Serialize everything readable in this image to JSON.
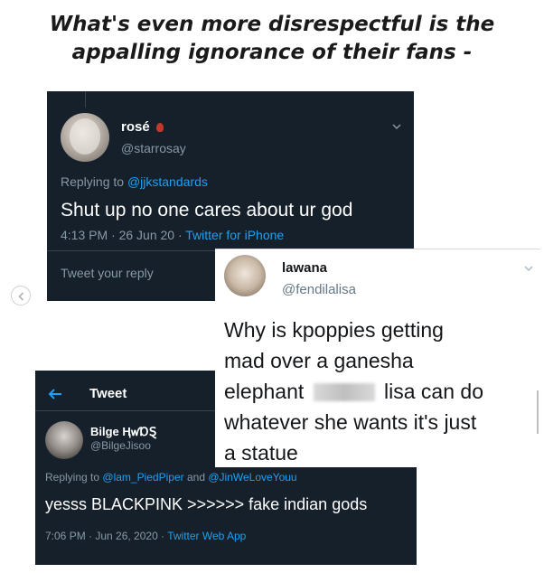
{
  "headline": {
    "line1": "What's even more disrespectful is the",
    "line2": "appalling ignorance of their fans -"
  },
  "tweet1": {
    "name": "rosé",
    "handle": "@starrosay",
    "replying_prefix": "Replying to",
    "replying_to": "@jjkstandards",
    "text": "Shut up no one cares about ur god",
    "time": "4:13 PM · 26 Jun 20 · ",
    "source": "Twitter for iPhone",
    "reply_placeholder": "Tweet your reply",
    "emoji_icon": "rose-icon"
  },
  "tweet2": {
    "name": "lawana",
    "handle": "@fendilalisa",
    "text_line1": "Why is kpoppies getting",
    "text_line2": "mad over a ganesha",
    "text_line3a": "elephant",
    "text_line3b": "lisa can do",
    "text_line4": "whatever she wants it's just",
    "text_line5": "a statue"
  },
  "tweet3": {
    "header_title": "Tweet",
    "name": "Bilge ⱧꛃⱰⱾ",
    "handle": "@BilgeJisoo",
    "replying_prefix": "Replying to",
    "replying_to_1": "@lam_PiedPiper",
    "replying_and": "and",
    "replying_to_2": "@JinWeLoveYouu",
    "text": "yesss BLACKPINK >>>>>> fake indian gods",
    "time": "7:06 PM · Jun 26, 2020 · ",
    "source": "Twitter Web App"
  },
  "colors": {
    "dark_bg": "#15202b",
    "twitter_blue": "#1da1f2",
    "muted_text": "#8899a6"
  }
}
